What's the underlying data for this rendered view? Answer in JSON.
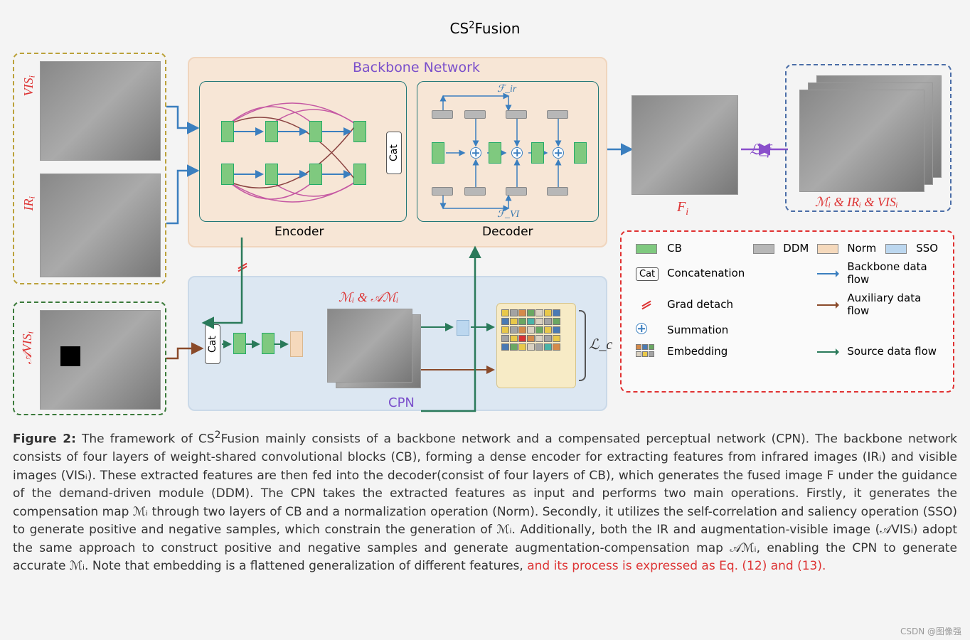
{
  "title_main": "CS",
  "title_sup": "2",
  "title_rest": "Fusion",
  "inputs": {
    "vis": "VIS",
    "ir": "IR",
    "avis": "𝒜VIS",
    "sub": "i"
  },
  "backbone": {
    "title": "Backbone Network",
    "encoder": "Encoder",
    "decoder": "Decoder",
    "cat": "Cat",
    "f_ir": "ℱ_ir",
    "f_vi": "ℱ_VI"
  },
  "cpn": {
    "title": "CPN",
    "mi_label": "ℳᵢ & 𝒜ℳᵢ",
    "cat": "Cat",
    "lc": "ℒ_c"
  },
  "output": {
    "fi": "F",
    "fi_sub": "i",
    "lf": "ℒ_f",
    "right_label": "ℳᵢ & IRᵢ & VISᵢ"
  },
  "legend": {
    "cb": "CB",
    "ddm": "DDM",
    "norm": "Norm",
    "sso": "SSO",
    "cat": "Cat",
    "concat": "Concatenation",
    "grad": "Grad detach",
    "sum": "Summation",
    "emb": "Embedding",
    "bbflow": "Backbone data flow",
    "auxflow": "Auxiliary data flow",
    "srcflow": "Source data flow"
  },
  "caption": {
    "figno": "Figure 2:",
    "body1": " The framework of CS",
    "sup": "2",
    "body2": "Fusion mainly consists of a backbone network and a compensated perceptual network (CPN). The backbone network consists of four layers of weight-shared convolutional blocks (CB), forming a dense encoder for extracting features from infrared images (IRᵢ) and visible images (VISᵢ). These extracted features are then fed into the decoder(consist of four layers of CB), which generates the fused image F under the guidance of the demand-driven module (DDM). The CPN takes the extracted features as input and performs two main operations. Firstly, it generates the compensation map ℳᵢ through two layers of CB and a normalization operation (Norm). Secondly, it utilizes the self-correlation and saliency operation (SSO) to generate positive and negative samples, which constrain the generation of ℳᵢ. Additionally, both the IR and augmentation-visible image (𝒜VISᵢ) adopt the same approach to construct positive and negative samples and generate augmentation-compensation map 𝒜ℳᵢ, enabling the CPN to generate accurate ℳᵢ. Note that embedding is a flattened generalization of different features, ",
    "eq_part": "and its process is expressed as Eq. (12) and (13)."
  },
  "watermark": "CSDN @图像强",
  "colors": {
    "cb": "#7fc97f",
    "ddm": "#b7b7b7",
    "norm": "#f5d9bc",
    "sso": "#bcd7ef",
    "backbone_flow": "#3b7fbf",
    "aux_flow": "#8a4a2a",
    "src_flow": "#2a7a5a"
  }
}
